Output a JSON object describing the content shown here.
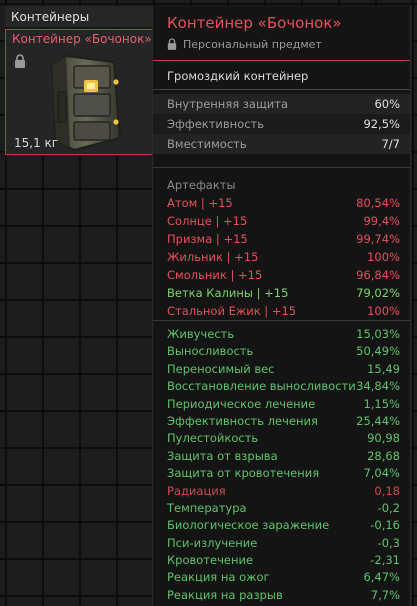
{
  "inventory": {
    "header": "Контейнеры",
    "item": {
      "name": "Контейнер «Бочонок»",
      "weight": "15,1 кг"
    }
  },
  "tooltip": {
    "title": "Контейнер «Бочонок»",
    "subtitle": "Персональный предмет",
    "type": "Громоздкий контейнер",
    "stats": [
      {
        "label": "Внутренняя защита",
        "value": "60%"
      },
      {
        "label": "Эффективность",
        "value": "92,5%"
      },
      {
        "label": "Вместимость",
        "value": "7/7"
      }
    ],
    "artifacts_header": "Артефакты",
    "artifacts": [
      {
        "label": "Атом | +15",
        "value": "80,54%",
        "color": "#e5505e"
      },
      {
        "label": "Солнце | +15",
        "value": "99,4%",
        "color": "#e5505e"
      },
      {
        "label": "Призма | +15",
        "value": "99,74%",
        "color": "#e5505e"
      },
      {
        "label": "Жильник | +15",
        "value": "100%",
        "color": "#e5505e"
      },
      {
        "label": "Смольник | +15",
        "value": "96,84%",
        "color": "#e5505e"
      },
      {
        "label": "Ветка Калины | +15",
        "value": "79,02%",
        "color": "#7fd36e"
      },
      {
        "label": "Стальной Ежик | +15",
        "value": "100%",
        "color": "#e5505e"
      }
    ],
    "effects": [
      {
        "label": "Живучесть",
        "value": "15,03%",
        "color": "#5ec46a"
      },
      {
        "label": "Выносливость",
        "value": "50,49%",
        "color": "#5ec46a"
      },
      {
        "label": "Переносимый вес",
        "value": "15,49",
        "color": "#5ec46a"
      },
      {
        "label": "Восстановление выносливости",
        "value": "34,84%",
        "color": "#5ec46a"
      },
      {
        "label": "Периодическое лечение",
        "value": "1,15%",
        "color": "#5ec46a"
      },
      {
        "label": "Эффективность лечения",
        "value": "25,44%",
        "color": "#5ec46a"
      },
      {
        "label": "Пулестойкость",
        "value": "90,98",
        "color": "#5ec46a"
      },
      {
        "label": "Защита от взрыва",
        "value": "28,68",
        "color": "#5ec46a"
      },
      {
        "label": "Защита от кровотечения",
        "value": "7,04%",
        "color": "#5ec46a"
      },
      {
        "label": "Радиация",
        "value": "0,18",
        "color": "#d2484f"
      },
      {
        "label": "Температура",
        "value": "-0,2",
        "color": "#5ec46a"
      },
      {
        "label": "Биологическое заражение",
        "value": "-0,16",
        "color": "#5ec46a"
      },
      {
        "label": "Пси-излучение",
        "value": "-0,3",
        "color": "#5ec46a"
      },
      {
        "label": "Кровотечение",
        "value": "-2,31",
        "color": "#5ec46a"
      },
      {
        "label": "Реакция на ожог",
        "value": "6,47%",
        "color": "#5ec46a"
      },
      {
        "label": "Реакция на разрыв",
        "value": "7,7%",
        "color": "#5ec46a"
      }
    ]
  }
}
